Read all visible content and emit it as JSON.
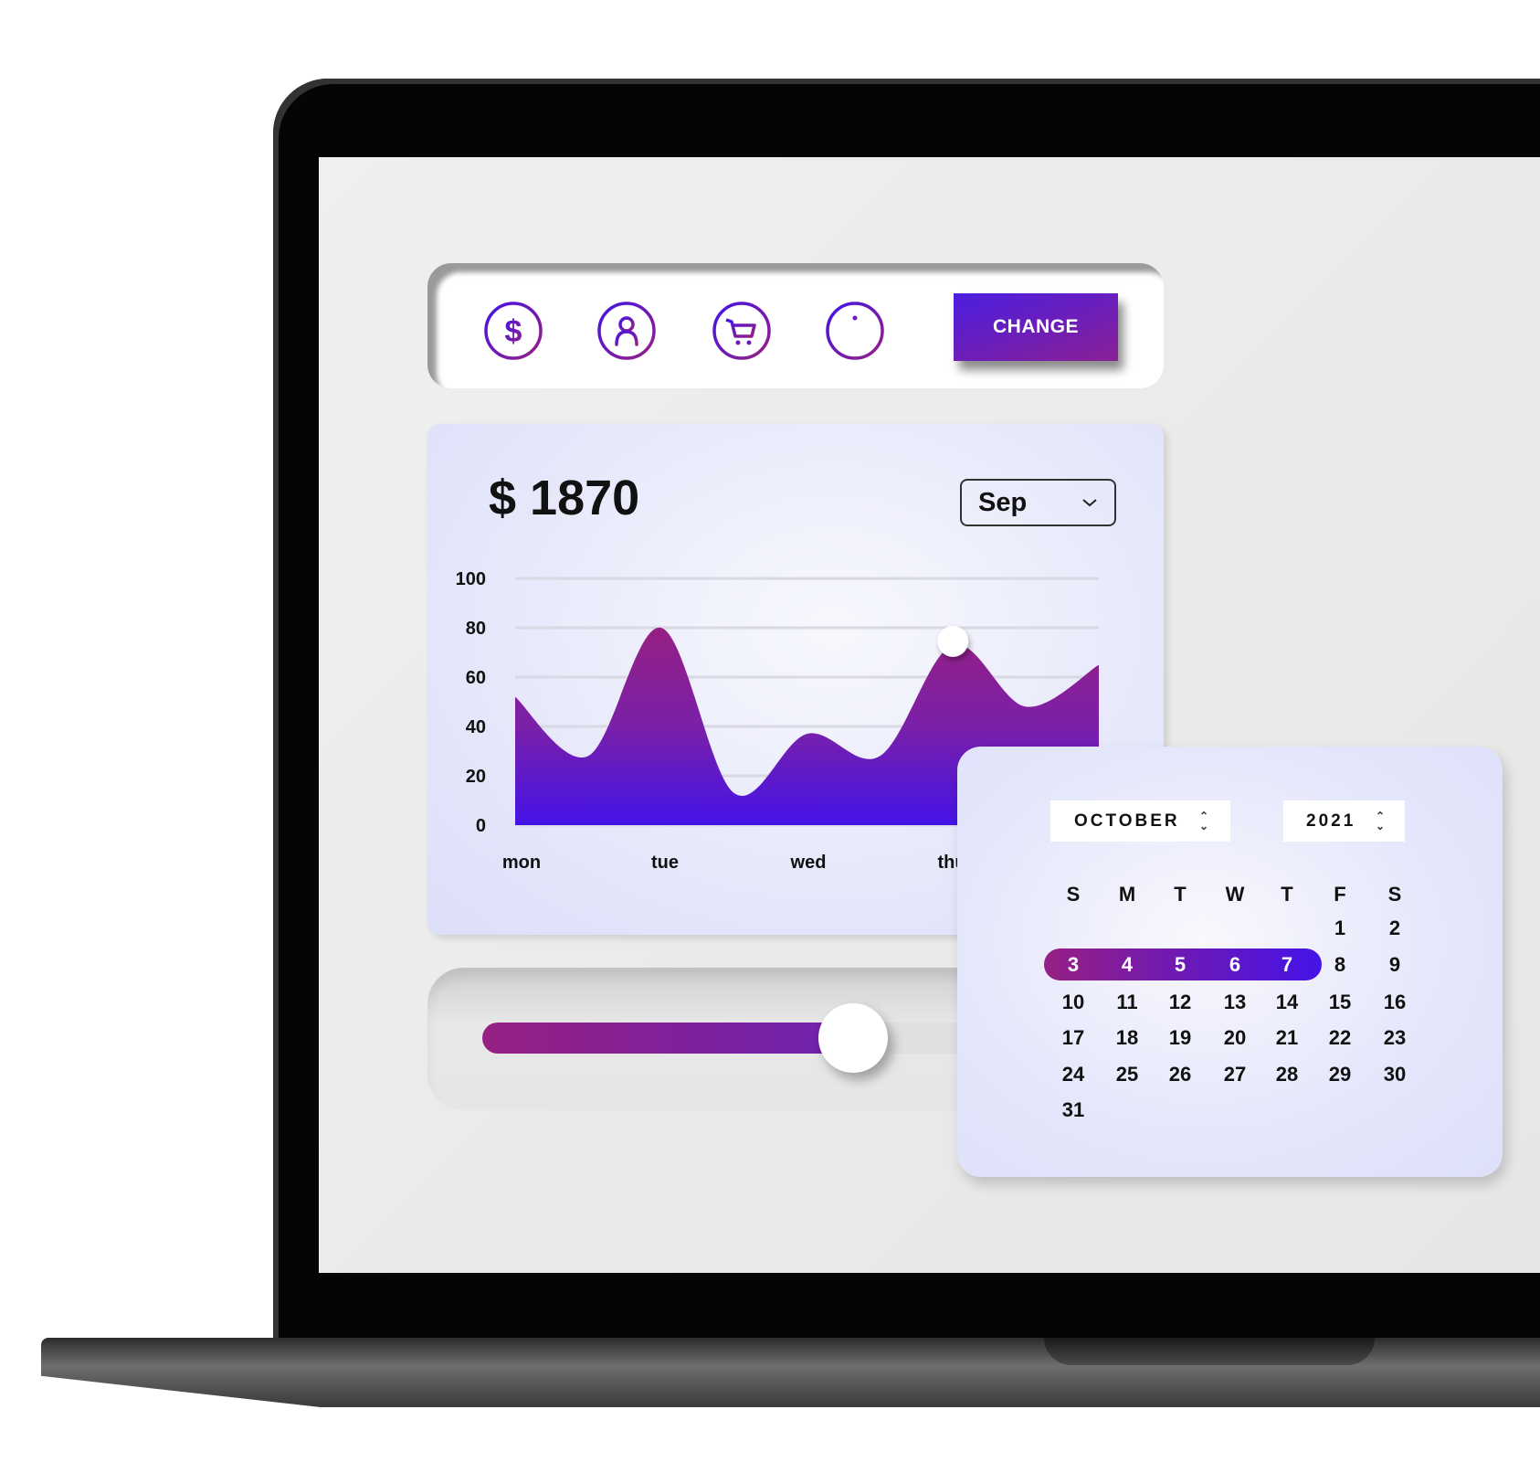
{
  "toolbar": {
    "icons": [
      "dollar-icon",
      "user-icon",
      "cart-icon",
      "info-icon"
    ],
    "change_label": "CHANGE"
  },
  "summary": {
    "amount": "$ 1870",
    "month_select": "Sep"
  },
  "chart_data": {
    "type": "area",
    "categories": [
      "mon",
      "tue",
      "wed",
      "thu"
    ],
    "values": [
      52,
      28,
      80,
      13,
      37,
      28,
      73,
      48,
      65
    ],
    "highlight_index": 6,
    "yticks": [
      "100",
      "80",
      "60",
      "40",
      "20",
      "0"
    ],
    "ylim": [
      0,
      100
    ],
    "grid": true,
    "colors": {
      "top": "#962083",
      "bottom": "#4413e8"
    }
  },
  "slider": {
    "value_percent": 58
  },
  "calendar": {
    "month": "OCTOBER",
    "year": "2021",
    "weekdays": [
      "S",
      "M",
      "T",
      "W",
      "T",
      "F",
      "S"
    ],
    "days": [
      "1",
      "2",
      "3",
      "4",
      "5",
      "6",
      "7",
      "8",
      "9",
      "10",
      "11",
      "12",
      "13",
      "14",
      "15",
      "16",
      "17",
      "18",
      "19",
      "20",
      "21",
      "22",
      "23",
      "24",
      "25",
      "26",
      "27",
      "28",
      "29",
      "30",
      "31"
    ],
    "first_weekday": 5,
    "selected_range": [
      "3",
      "7"
    ]
  },
  "colors": {
    "accent_purple": "#962083",
    "accent_blue": "#4413e8"
  }
}
